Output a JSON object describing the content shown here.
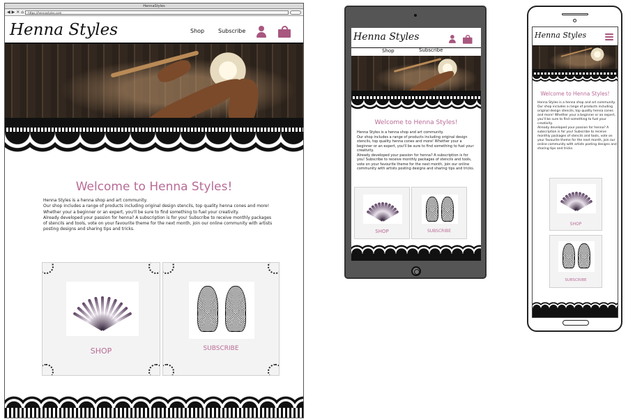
{
  "brand_color": "#b86b96",
  "site": {
    "logo": "Henna Styles",
    "window_title": "HennaStyles",
    "url": "https://hennastyles.com",
    "nav": {
      "shop": "Shop",
      "subscribe": "Subscribe"
    },
    "icons": {
      "account": "user-icon",
      "cart": "shopping-bag-icon",
      "menu": "hamburger-menu-icon"
    },
    "welcome": "Welcome to Henna Styles!",
    "intro": [
      "Henna Styles is a henna shop and art community.",
      "Our shop includes a range of products including original design stencils, top quality henna cones and more! Whether your a beginner or an expert, you'll be sure to find something to fuel your creativity.",
      "Already developed your passion for henna? A subscription is for you! Subscribe to receive monthly packages of stencils and tools, vote on your favourite theme for the next month, join our online community with artists posting designs and sharing tips and tricks."
    ],
    "cards": {
      "shop": "SHOP",
      "subscribe": "SUBSCRIBE"
    }
  }
}
